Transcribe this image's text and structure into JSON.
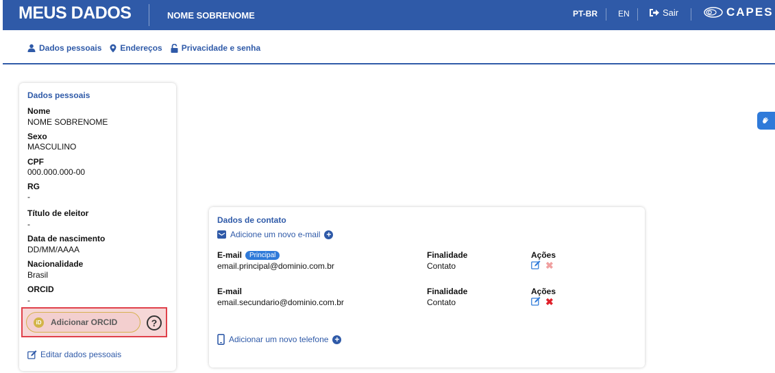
{
  "header": {
    "title": "MEUS DADOS",
    "user_name": "NOME SOBRENOME",
    "lang_pt": "PT-BR",
    "lang_en": "EN",
    "logout_label": "Sair",
    "brand": "CAPES"
  },
  "nav": {
    "items": [
      {
        "label": "Dados pessoais",
        "icon": "user-icon"
      },
      {
        "label": "Endereços",
        "icon": "map-pin-icon"
      },
      {
        "label": "Privacidade e senha",
        "icon": "lock-icon"
      }
    ]
  },
  "personal": {
    "title": "Dados pessoais",
    "fields": [
      {
        "label": "Nome",
        "value": "NOME SOBRENOME"
      },
      {
        "label": "Sexo",
        "value": "MASCULINO"
      },
      {
        "label": "CPF",
        "value": "000.000.000-00"
      },
      {
        "label": "RG",
        "value": "-"
      },
      {
        "label": "Título de eleitor",
        "value": "-"
      },
      {
        "label": "Data de nascimento",
        "value": "DD/MM/AAAA"
      },
      {
        "label": "Nacionalidade",
        "value": "Brasil"
      },
      {
        "label": "ORCID",
        "value": "-"
      }
    ],
    "orcid_button": "Adicionar ORCID",
    "orcid_logo_text": "iD",
    "help_symbol": "?",
    "edit_link": "Editar dados pessoais"
  },
  "contact": {
    "title": "Dados de contato",
    "add_email": "Adicione um novo e-mail",
    "emails": [
      {
        "label": "E-mail",
        "badge": "Principal",
        "value": "email.principal@dominio.com.br",
        "purpose_label": "Finalidade",
        "purpose": "Contato",
        "actions_label": "Ações"
      },
      {
        "label": "E-mail",
        "badge": "",
        "value": "email.secundario@dominio.com.br",
        "purpose_label": "Finalidade",
        "purpose": "Contato",
        "actions_label": "Ações"
      }
    ],
    "add_phone": "Adicionar um novo telefone"
  },
  "colors": {
    "primary": "#2f5aa8",
    "highlight_border": "#e0404a",
    "delete_disabled": "#f0a0a0",
    "delete_active": "#e0202a"
  }
}
